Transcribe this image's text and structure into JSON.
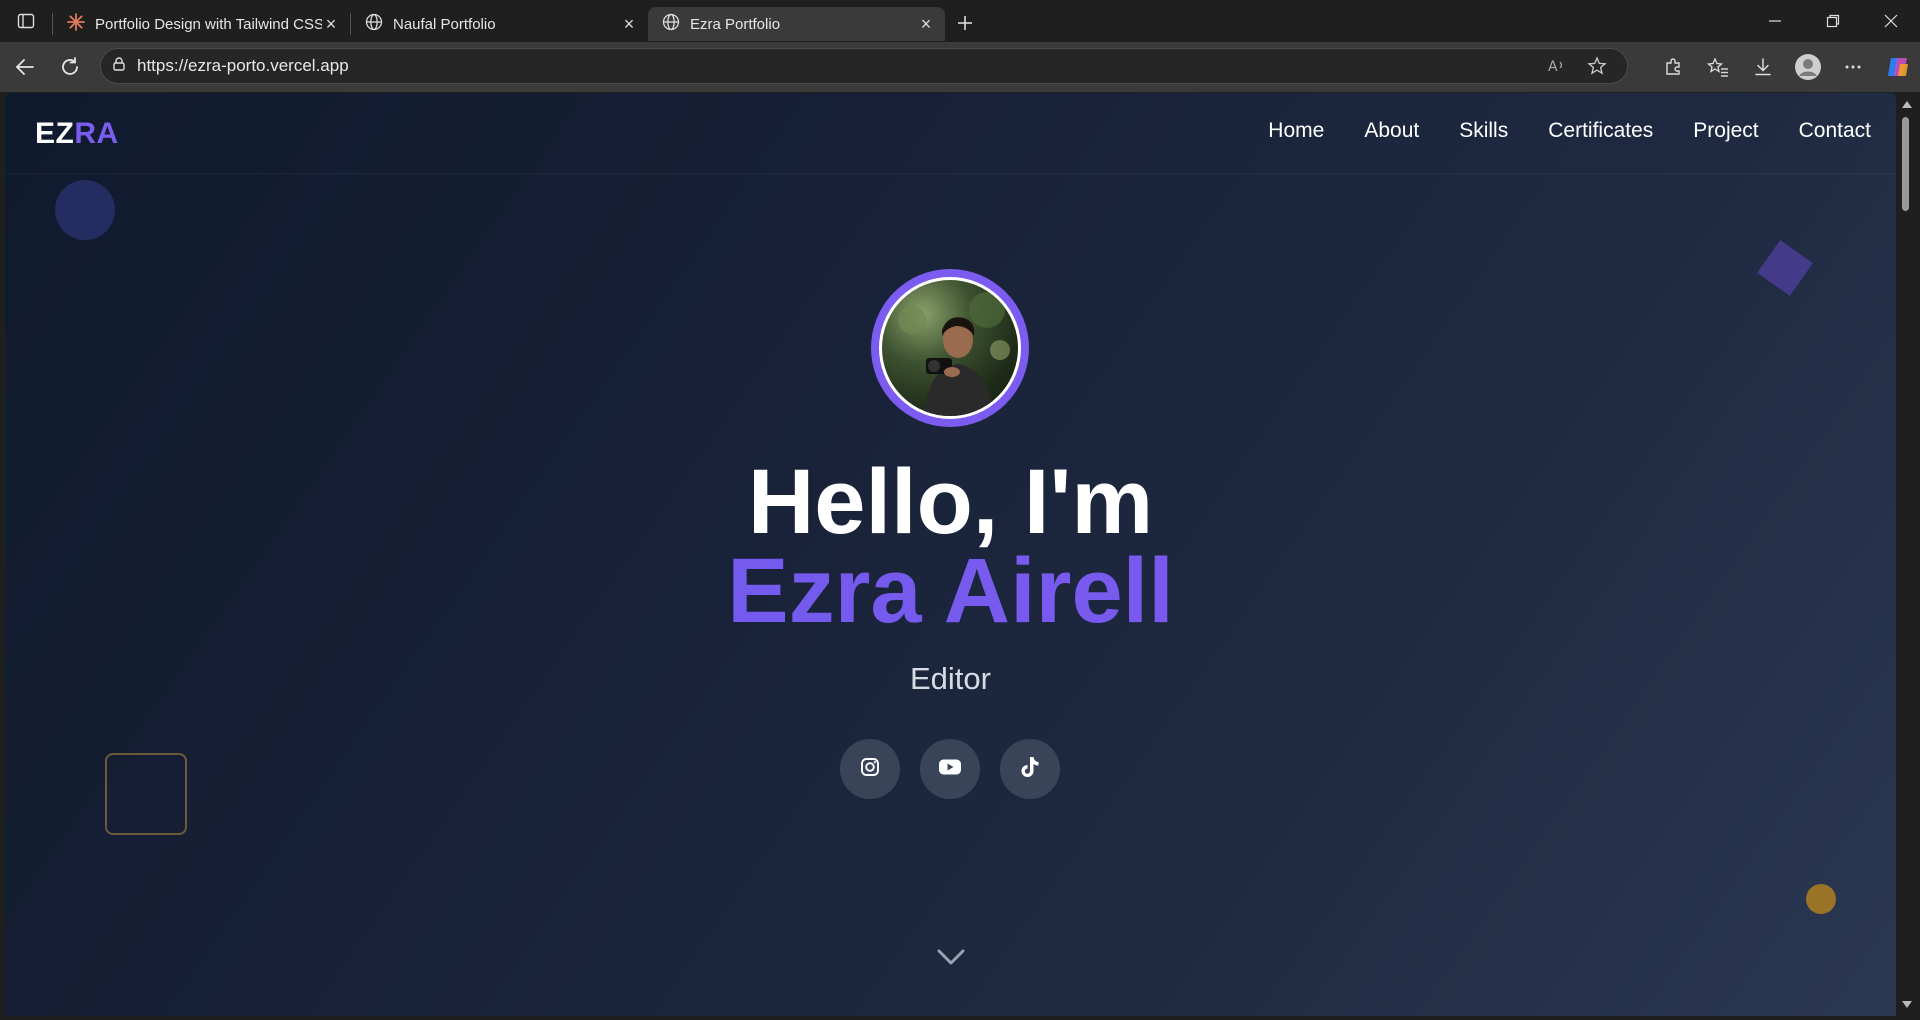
{
  "browser": {
    "tabs": [
      {
        "title": "Portfolio Design with Tailwind CSS",
        "icon": "sparkle-icon",
        "active": false
      },
      {
        "title": "Naufal Portfolio",
        "icon": "globe-icon",
        "active": false
      },
      {
        "title": "Ezra Portfolio",
        "icon": "globe-icon",
        "active": true
      }
    ],
    "url": "https://ezra-porto.vercel.app"
  },
  "site": {
    "logo_part1": "EZ",
    "logo_part2": "RA",
    "nav": [
      "Home",
      "About",
      "Skills",
      "Certificates",
      "Project",
      "Contact"
    ],
    "hero": {
      "greeting": "Hello, I'm",
      "name": "Ezra Airell",
      "role": "Editor"
    },
    "socials": [
      {
        "name": "instagram-icon"
      },
      {
        "name": "youtube-icon"
      },
      {
        "name": "tiktok-icon"
      }
    ],
    "colors": {
      "accent": "#7c5cf0",
      "background_start": "#101a2e",
      "background_end": "#2b3852"
    }
  }
}
